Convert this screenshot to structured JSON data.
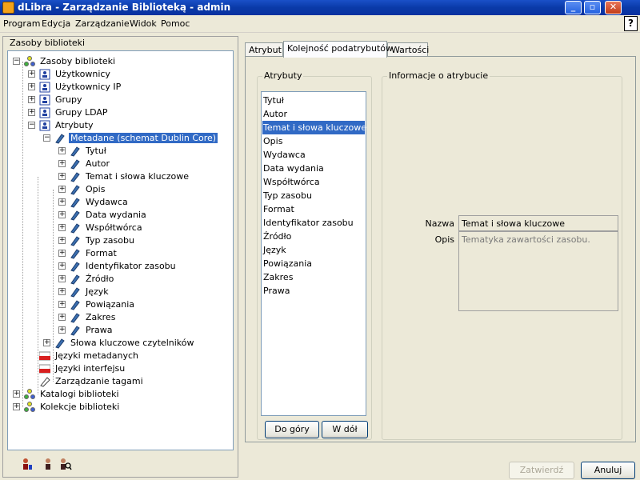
{
  "window": {
    "title": "dLibra - Zarządzanie Biblioteką - admin",
    "buttons": [
      "_",
      "▫",
      "✕"
    ]
  },
  "menu": {
    "items": [
      "Program",
      "Edycja",
      "Zarządzanie",
      "Widok",
      "Pomoc"
    ],
    "help_symbol": "?"
  },
  "left_panel": {
    "title": "Zasoby biblioteki",
    "tree": [
      {
        "label": "Zasoby biblioteki",
        "level": 0,
        "expander": "−",
        "icon": "library-icon"
      },
      {
        "label": "Użytkownicy",
        "level": 1,
        "expander": "+",
        "icon": "users-icon"
      },
      {
        "label": "Użytkownicy IP",
        "level": 1,
        "expander": "+",
        "icon": "ip-users-icon"
      },
      {
        "label": "Grupy",
        "level": 1,
        "expander": "+",
        "icon": "groups-icon"
      },
      {
        "label": "Grupy LDAP",
        "level": 1,
        "expander": "+",
        "icon": "ldap-groups-icon"
      },
      {
        "label": "Atrybuty",
        "level": 1,
        "expander": "−",
        "icon": "attributes-icon"
      },
      {
        "label": "Metadane (schemat Dublin Core)",
        "level": 2,
        "expander": "−",
        "icon": "attribute-icon",
        "selected": true
      },
      {
        "label": "Tytuł",
        "level": 3,
        "expander": "+",
        "icon": "attribute-icon"
      },
      {
        "label": "Autor",
        "level": 3,
        "expander": "+",
        "icon": "attribute-icon"
      },
      {
        "label": "Temat i słowa kluczowe",
        "level": 3,
        "expander": "+",
        "icon": "attribute-icon"
      },
      {
        "label": "Opis",
        "level": 3,
        "expander": "+",
        "icon": "attribute-icon"
      },
      {
        "label": "Wydawca",
        "level": 3,
        "expander": "+",
        "icon": "attribute-icon"
      },
      {
        "label": "Data wydania",
        "level": 3,
        "expander": "+",
        "icon": "attribute-icon"
      },
      {
        "label": "Współtwórca",
        "level": 3,
        "expander": "+",
        "icon": "attribute-icon"
      },
      {
        "label": "Typ zasobu",
        "level": 3,
        "expander": "+",
        "icon": "attribute-icon"
      },
      {
        "label": "Format",
        "level": 3,
        "expander": "+",
        "icon": "attribute-icon"
      },
      {
        "label": "Identyfikator zasobu",
        "level": 3,
        "expander": "+",
        "icon": "attribute-icon"
      },
      {
        "label": "Źródło",
        "level": 3,
        "expander": "+",
        "icon": "attribute-icon"
      },
      {
        "label": "Język",
        "level": 3,
        "expander": "+",
        "icon": "attribute-icon"
      },
      {
        "label": "Powiązania",
        "level": 3,
        "expander": "+",
        "icon": "attribute-icon"
      },
      {
        "label": "Zakres",
        "level": 3,
        "expander": "+",
        "icon": "attribute-icon"
      },
      {
        "label": "Prawa",
        "level": 3,
        "expander": "+",
        "icon": "attribute-icon"
      },
      {
        "label": "Słowa kluczowe czytelników",
        "level": 2,
        "expander": "+",
        "icon": "attribute-icon"
      },
      {
        "label": "Języki metadanych",
        "level": 1,
        "expander": "",
        "icon": "flag-icon"
      },
      {
        "label": "Języki interfejsu",
        "level": 1,
        "expander": "",
        "icon": "flag-icon"
      },
      {
        "label": "Zarządzanie tagami",
        "level": 1,
        "expander": "",
        "icon": "tags-icon"
      },
      {
        "label": "Katalogi biblioteki",
        "level": 0,
        "expander": "+",
        "icon": "catalog-icon"
      },
      {
        "label": "Kolekcje biblioteki",
        "level": 0,
        "expander": "+",
        "icon": "collections-icon"
      }
    ],
    "bottom_icons": [
      "user-red-icon",
      "user-icon",
      "user-search-icon"
    ]
  },
  "tabs": [
    {
      "label": "Atrybut"
    },
    {
      "label": "Kolejność podatrybutów",
      "active": true
    },
    {
      "label": "Wartości"
    }
  ],
  "attributes_group": {
    "title": "Atrybuty",
    "items": [
      "Tytuł",
      "Autor",
      "Temat i słowa kluczowe",
      "Opis",
      "Wydawca",
      "Data wydania",
      "Współtwórca",
      "Typ zasobu",
      "Format",
      "Identyfikator zasobu",
      "Źródło",
      "Język",
      "Powiązania",
      "Zakres",
      "Prawa"
    ],
    "selected_index": 2,
    "up_button": "Do góry",
    "down_button": "W dół"
  },
  "info_group": {
    "title": "Informacje o atrybucie",
    "name_label": "Nazwa",
    "name_value": "Temat i słowa kluczowe",
    "desc_label": "Opis",
    "desc_value": "Tematyka zawartości zasobu."
  },
  "footer": {
    "confirm_button": "Zatwierdź",
    "cancel_button": "Anuluj"
  }
}
